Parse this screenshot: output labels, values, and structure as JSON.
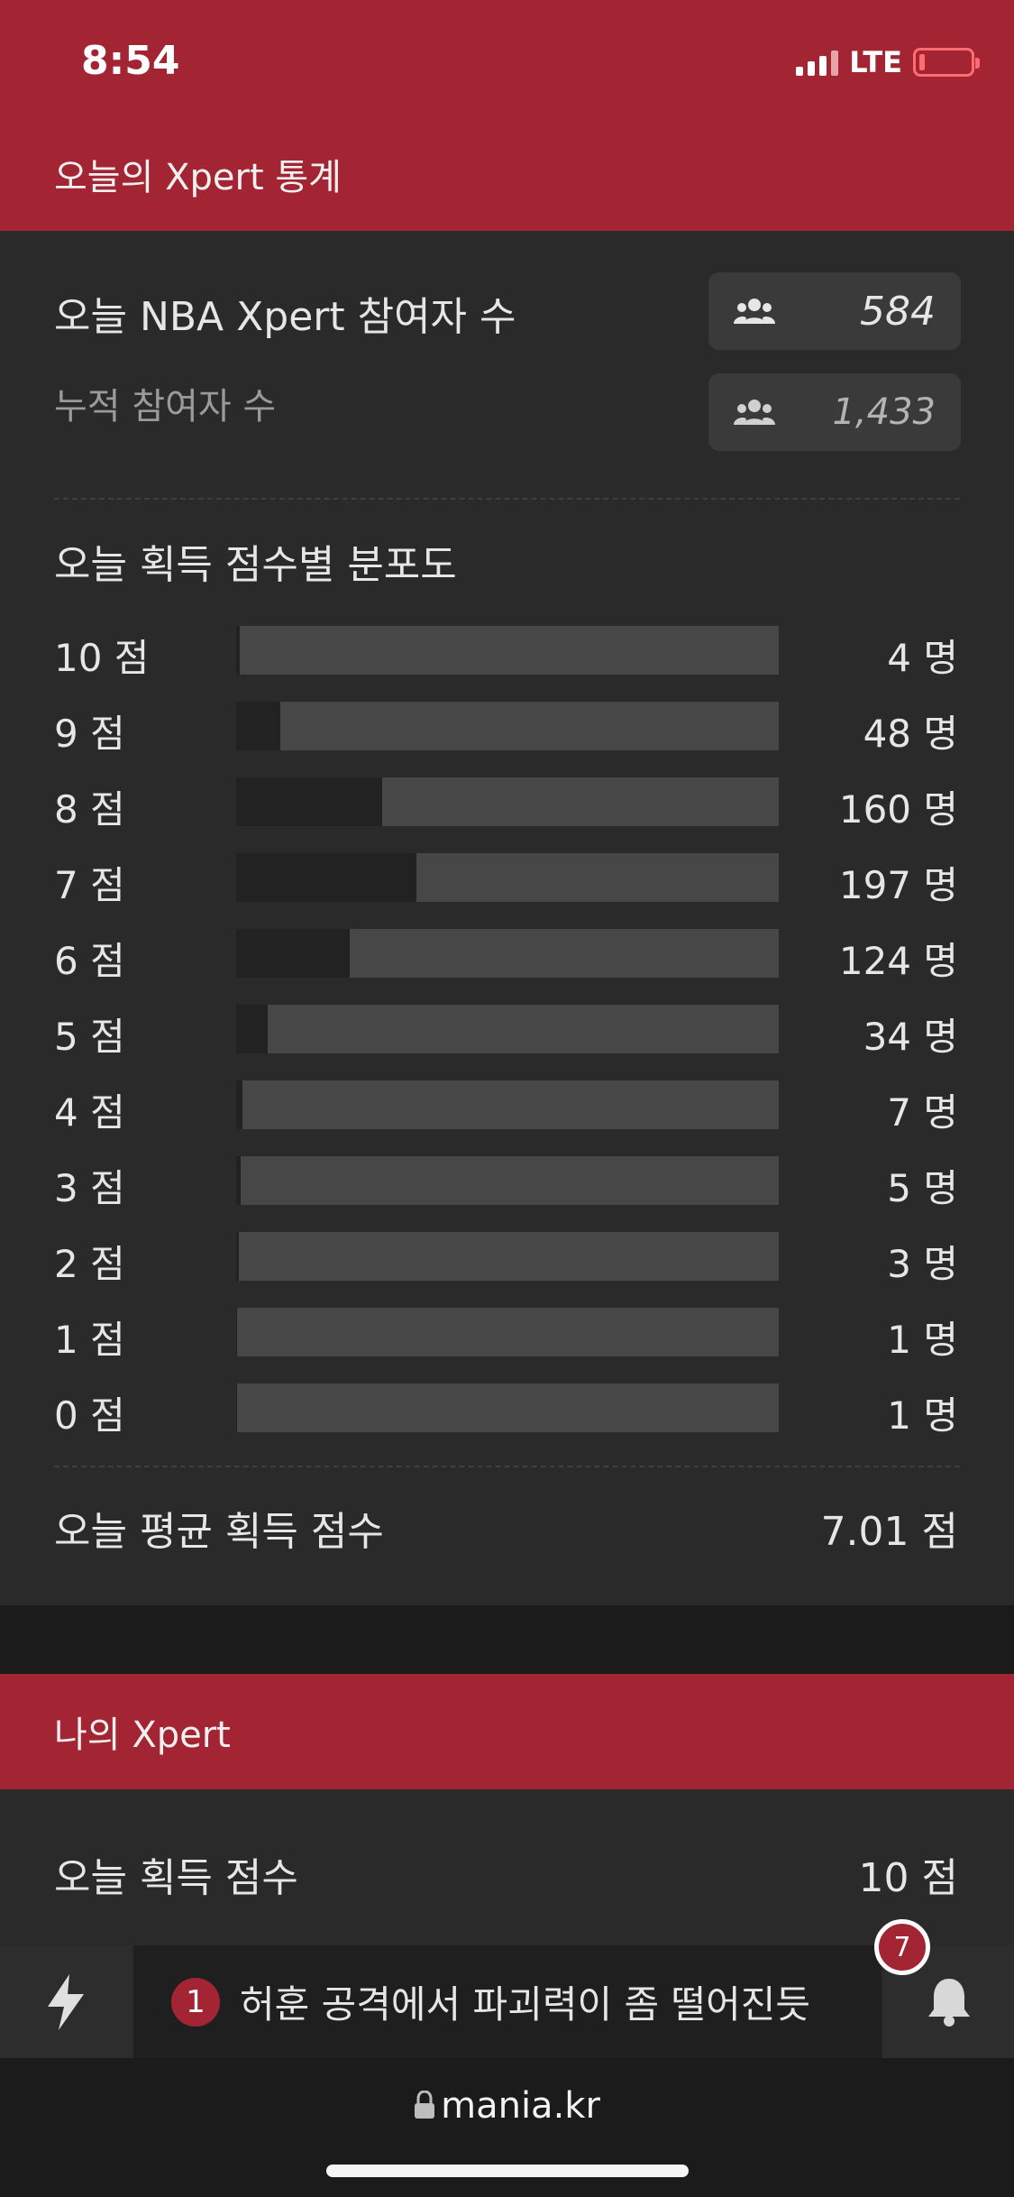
{
  "status": {
    "time": "8:54",
    "network": "LTE"
  },
  "stats": {
    "header": "오늘의 Xpert 통계",
    "participants_label": "오늘 NBA Xpert 참여자 수",
    "participants_value": "584",
    "cumulative_label": "누적 참여자 수",
    "cumulative_value": "1,433",
    "dist_title": "오늘 획득 점수별 분포도",
    "avg_label": "오늘 평균 획득 점수",
    "avg_value": "7.01 점"
  },
  "chart_data": {
    "type": "bar",
    "categories": [
      "10 점",
      "9 점",
      "8 점",
      "7 점",
      "6 점",
      "5 점",
      "4 점",
      "3 점",
      "2 점",
      "1 점",
      "0 점"
    ],
    "values": [
      4,
      48,
      160,
      197,
      124,
      34,
      7,
      5,
      3,
      1,
      1
    ],
    "value_labels": [
      "4 명",
      "48 명",
      "160 명",
      "197 명",
      "124 명",
      "34 명",
      "7 명",
      "5 명",
      "3 명",
      "1 명",
      "1 명"
    ]
  },
  "my_xpert": {
    "header": "나의 Xpert",
    "score_label": "오늘 획득 점수",
    "score_value": "10 점"
  },
  "ticker": {
    "number": "1",
    "text": "허훈 공격에서 파괴력이 좀 떨어진듯"
  },
  "notifications": {
    "count": "7"
  },
  "browser": {
    "url": "mania.kr"
  },
  "icons": {
    "participants": "users-icon",
    "bolt": "bolt-icon",
    "bell": "bell-icon",
    "lock": "lock-icon"
  }
}
